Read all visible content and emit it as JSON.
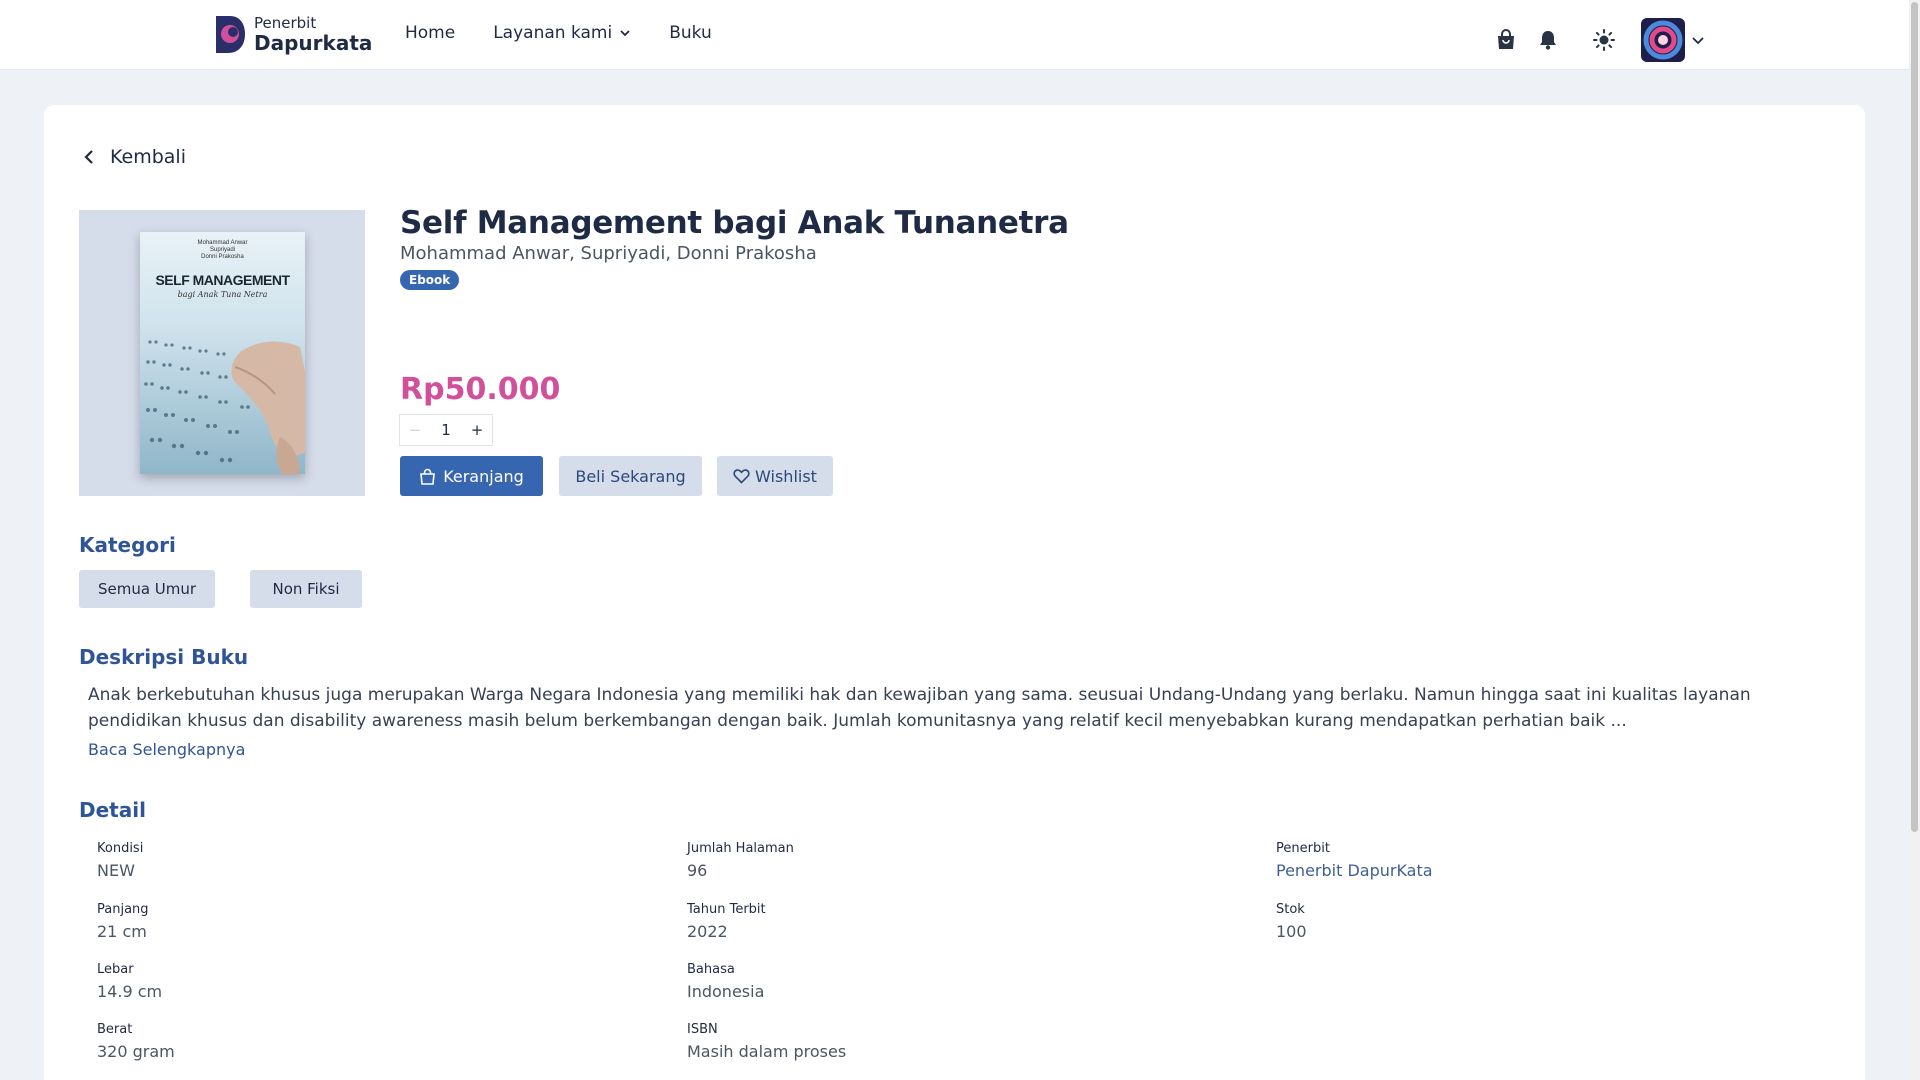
{
  "brand": {
    "small": "Penerbit",
    "big": "Dapurkata"
  },
  "nav": {
    "home": "Home",
    "services": "Layanan kami",
    "books": "Buku"
  },
  "icons": [
    "cart-icon",
    "bell-icon",
    "sun-icon",
    "avatar",
    "chevron-down-icon"
  ],
  "back_label": "Kembali",
  "book": {
    "cover": {
      "authors": [
        "Mohammad Anwar",
        "Supriyadi",
        "Donni Prakosha"
      ],
      "title": "SELF MANAGEMENT",
      "subtitle": "bagi Anak Tuna Netra"
    },
    "title": "Self Management bagi Anak Tunanetra",
    "authors": "Mohammad Anwar, Supriyadi, Donni Prakosha",
    "format_badge": "Ebook",
    "price": "Rp50.000",
    "quantity": "1",
    "qty_minus": "−",
    "qty_plus": "+"
  },
  "actions": {
    "cart": "Keranjang",
    "buy_now": "Beli Sekarang",
    "wishlist": "Wishlist"
  },
  "category": {
    "heading": "Kategori",
    "chips": [
      "Semua Umur",
      "Non Fiksi"
    ]
  },
  "description": {
    "heading": "Deskripsi Buku",
    "text": "Anak berkebutuhan khusus juga merupakan Warga Negara Indonesia yang memiliki hak dan kewajiban yang sama. seusuai Undang-Undang yang berlaku. Namun hingga saat ini kualitas layanan pendidikan khusus dan disability awareness masih belum berkembangan dengan baik. Jumlah komunitasnya yang relatif kecil menyebabkan kurang mendapatkan perhatian baik ...",
    "read_more": "Baca Selengkapnya"
  },
  "detail": {
    "heading": "Detail",
    "col1": [
      {
        "label": "Kondisi",
        "value": "NEW"
      },
      {
        "label": "Panjang",
        "value": "21 cm"
      },
      {
        "label": "Lebar",
        "value": "14.9 cm"
      },
      {
        "label": "Berat",
        "value": "320 gram"
      }
    ],
    "col2": [
      {
        "label": "Jumlah Halaman",
        "value": "96"
      },
      {
        "label": "Tahun Terbit",
        "value": "2022"
      },
      {
        "label": "Bahasa",
        "value": "Indonesia"
      },
      {
        "label": "ISBN",
        "value": "Masih dalam proses"
      }
    ],
    "col3": [
      {
        "label": "Penerbit",
        "value": "Penerbit DapurKata"
      },
      {
        "label": "Stok",
        "value": "100"
      }
    ]
  },
  "colors": {
    "primary": "#3766b0",
    "price": "#d14f9b",
    "heading": "#2f5596",
    "chip": "#d5dcea"
  }
}
